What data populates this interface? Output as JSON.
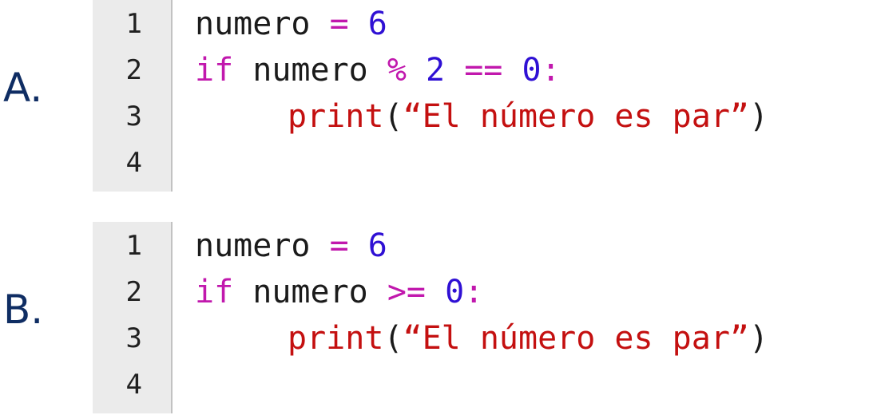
{
  "options": [
    {
      "letter": "A.",
      "line_numbers": [
        "1",
        "2",
        "3",
        "4"
      ],
      "lines": [
        [
          {
            "text": "numero ",
            "type": "default"
          },
          {
            "text": "=",
            "type": "operator"
          },
          {
            "text": " ",
            "type": "default"
          },
          {
            "text": "6",
            "type": "number"
          }
        ],
        [
          {
            "text": "if",
            "type": "keyword"
          },
          {
            "text": " numero ",
            "type": "default"
          },
          {
            "text": "%",
            "type": "operator"
          },
          {
            "text": " ",
            "type": "default"
          },
          {
            "text": "2",
            "type": "number"
          },
          {
            "text": " ",
            "type": "default"
          },
          {
            "text": "==",
            "type": "operator"
          },
          {
            "text": " ",
            "type": "default"
          },
          {
            "text": "0",
            "type": "number"
          },
          {
            "text": ":",
            "type": "operator"
          }
        ],
        [
          {
            "text": "print",
            "type": "builtin"
          },
          {
            "text": "(",
            "type": "default"
          },
          {
            "text": "“El número es par”",
            "type": "string"
          },
          {
            "text": ")",
            "type": "default"
          }
        ],
        []
      ]
    },
    {
      "letter": "B.",
      "line_numbers": [
        "1",
        "2",
        "3",
        "4"
      ],
      "lines": [
        [
          {
            "text": "numero ",
            "type": "default"
          },
          {
            "text": "=",
            "type": "operator"
          },
          {
            "text": " ",
            "type": "default"
          },
          {
            "text": "6",
            "type": "number"
          }
        ],
        [
          {
            "text": "if",
            "type": "keyword"
          },
          {
            "text": " numero ",
            "type": "default"
          },
          {
            "text": ">=",
            "type": "operator"
          },
          {
            "text": " ",
            "type": "default"
          },
          {
            "text": "0",
            "type": "number"
          },
          {
            "text": ":",
            "type": "operator"
          }
        ],
        [
          {
            "text": "print",
            "type": "builtin"
          },
          {
            "text": "(",
            "type": "default"
          },
          {
            "text": "“El número es par”",
            "type": "string"
          },
          {
            "text": ")",
            "type": "default"
          }
        ],
        []
      ]
    }
  ],
  "colors": {
    "option_letter": "#0f2d63",
    "default": "#1b1b1b",
    "operator": "#c118ad",
    "keyword": "#c118ad",
    "number": "#2f10d4",
    "builtin": "#c41010",
    "string": "#c41010",
    "gutter_background": "#ebebeb",
    "gutter_border": "#c2c2c2"
  }
}
